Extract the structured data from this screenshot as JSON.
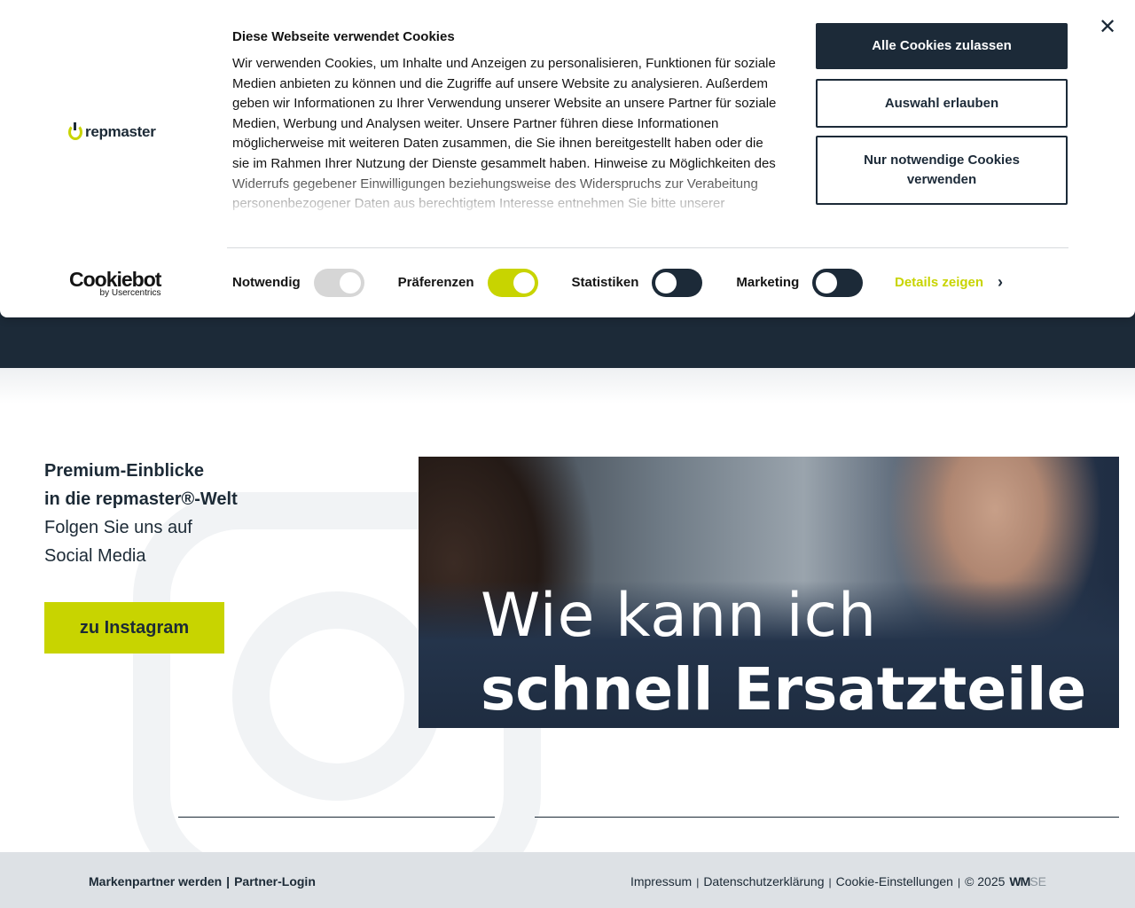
{
  "cookie_banner": {
    "brand": "repmaster",
    "title": "Diese Webseite verwendet Cookies",
    "body": "Wir verwenden Cookies, um Inhalte und Anzeigen zu personalisieren, Funktionen für soziale Medien anbieten zu können und die Zugriffe auf unsere Website zu analysieren. Außerdem geben wir Informationen zu Ihrer Verwendung unserer Website an unsere Partner für soziale Medien, Werbung und Analysen weiter. Unsere Partner führen diese Informationen möglicherweise mit weiteren Daten zusammen, die Sie ihnen bereitgestellt haben oder die sie im Rahmen Ihrer Nutzung der Dienste gesammelt haben. Hinweise zu Möglichkeiten des Widerrufs gegebener Einwilligungen beziehungsweise des Widerspruchs zur Verabeitung personenbezogener Daten aus berechtigtem Interesse entnehmen Sie bitte unserer Datenschutzerklärung.",
    "buttons": {
      "allow_all": "Alle Cookies zulassen",
      "allow_selection": "Auswahl erlauben",
      "necessary_only": "Nur notwendige Cookies verwenden"
    },
    "toggles": [
      {
        "label": "Notwendig",
        "state": "on-disabled"
      },
      {
        "label": "Präferenzen",
        "state": "on"
      },
      {
        "label": "Statistiken",
        "state": "off"
      },
      {
        "label": "Marketing",
        "state": "off"
      }
    ],
    "details_link": "Details zeigen",
    "provider": {
      "name": "Cookiebot",
      "sub": "by Usercentrics"
    }
  },
  "promo": {
    "line1": "Premium-Einblicke",
    "line2": "in die repmaster®-Welt",
    "line3": "Folgen Sie uns auf",
    "line4": "Social Media",
    "button": "zu Instagram"
  },
  "hero": {
    "line1": "Wie kann ich",
    "line2": "schnell Ersatzteile"
  },
  "footer": {
    "left": [
      "Markenpartner werden",
      "Partner-Login"
    ],
    "right": [
      "Impressum",
      "Datenschutzerklärung",
      "Cookie-Einstellungen"
    ],
    "copyright": "© 2025",
    "company_wm": "WM",
    "company_se": "SE"
  },
  "colors": {
    "accent": "#c8d400",
    "dark": "#1c2a38",
    "footer_bg": "#dde1e5"
  }
}
